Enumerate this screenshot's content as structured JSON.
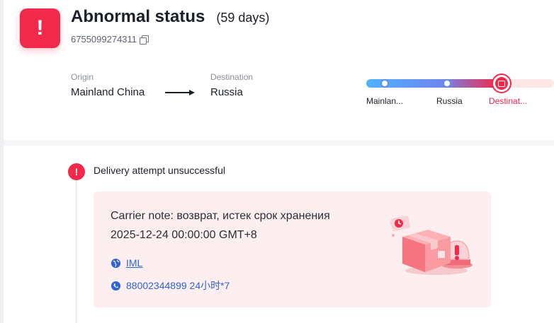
{
  "header": {
    "status_title": "Abnormal status",
    "days": "(59 days)",
    "tracking_number": "6755099274311",
    "status_color": "#f2294a"
  },
  "route": {
    "origin_label": "Origin",
    "origin_value": "Mainland China",
    "destination_label": "Destination",
    "destination_value": "Russia"
  },
  "progress": {
    "nodes": [
      {
        "label": "Mainlan..."
      },
      {
        "label": "Russia"
      },
      {
        "label": "Destinat..."
      }
    ]
  },
  "event": {
    "title": "Delivery attempt unsuccessful",
    "note": "Carrier note: возврат, истек срок хранения",
    "time": "2025-12-24 00:00:00 GMT+8",
    "carrier": "IML",
    "phone": "88002344899 24小时*7",
    "accent_color": "#2f63d8"
  }
}
